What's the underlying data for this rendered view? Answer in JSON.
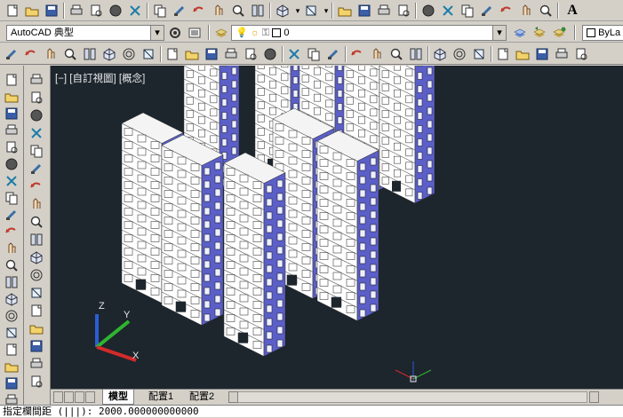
{
  "toolbar_top": {
    "icons": [
      "new-file-icon",
      "open-folder-icon",
      "save-icon",
      "print-icon",
      "plot-preview-icon",
      "publish-icon",
      "3d-dwf-icon",
      "cut-icon",
      "copy-icon",
      "copy-base-icon",
      "paste-icon",
      "match-properties-icon",
      "block-editor-icon",
      "undo-icon",
      "undo-dropdown-icon",
      "redo-icon",
      "redo-dropdown-icon",
      "pan-icon",
      "zoom-realtime-icon",
      "zoom-window-icon",
      "zoom-previous-icon",
      "properties-icon",
      "design-center-icon",
      "tool-palettes-icon",
      "sheet-set-icon",
      "markup-icon",
      "quickcalc-icon",
      "help-icon",
      "text-style-icon"
    ],
    "style_letter": "A"
  },
  "toolbar_workspace": {
    "workspace_value": "AutoCAD 典型",
    "layer_value": "0",
    "bylayer_value": "ByLa"
  },
  "viewport": {
    "label": "[−] [自訂視圖] [概念]",
    "background": "#1d252d",
    "building_face": "#ffffff",
    "building_shade": "#5b5fc7",
    "ucs_axes": [
      "Z",
      "Y",
      "X"
    ]
  },
  "tabs": {
    "items": [
      "模型",
      "配置1",
      "配置2"
    ],
    "active": "模型"
  },
  "command_line": {
    "text": "指定欄間距 (|||): 2000.000000000000"
  }
}
